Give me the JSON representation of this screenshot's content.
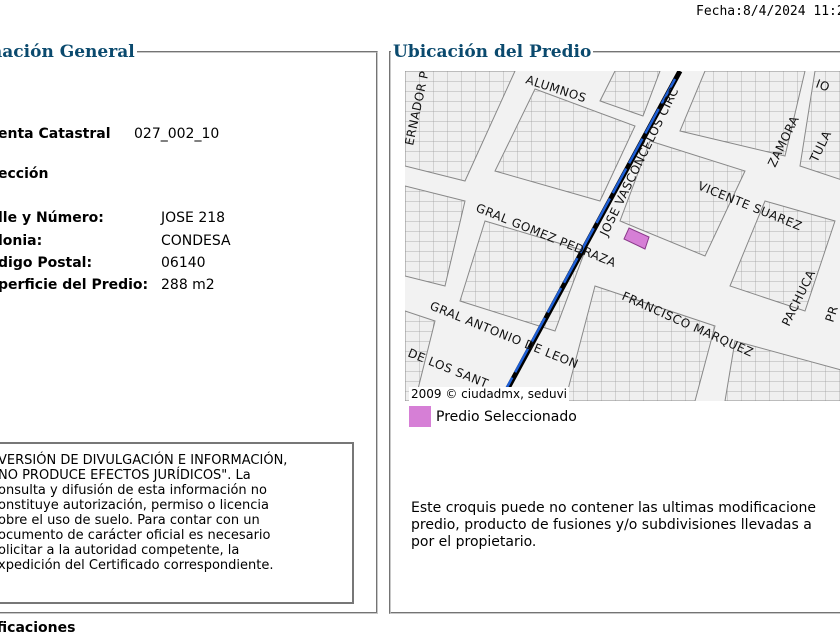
{
  "header": {
    "date": "Fecha:8/4/2024 11:2"
  },
  "general": {
    "legend": "ormación General",
    "cuenta_label": "enta Catastral",
    "cuenta_value": "027_002_10",
    "direccion_label": "ección",
    "calle_label": "lle y Número:",
    "calle_value": "JOSE 218",
    "colonia_label": "lonia:",
    "colonia_value": "CONDESA",
    "cp_label": "digo Postal:",
    "cp_value": "06140",
    "superficie_label": "perficie del Predio:",
    "superficie_value": "288 m2",
    "disclaimer_lines": [
      "VERSIÓN DE DIVULGACIÓN E INFORMACIÓN,",
      "NO PRODUCE EFECTOS JURÍDICOS\". La",
      "onsulta y difusión de esta información no",
      "onstituye autorización, permiso o licencia",
      "obre el uso de suelo. Para contar con un",
      "ocumento de carácter oficial es necesario",
      "olicitar a la autoridad competente, la",
      "xpedición del Certificado correspondiente."
    ]
  },
  "ubicacion": {
    "legend": "Ubicación del Predio",
    "map": {
      "streets": {
        "alumnos": "ALUMNOS",
        "gobernador": "ERNADOR PRO",
        "vasconcelos": "JOSE VASCONCELOS CIRC",
        "gomez_pedraza": "GRAL GOMEZ PEDRAZA",
        "vicente_suarez": "VICENTE SUAREZ",
        "zamora": "ZAMORA",
        "tula": "TULA",
        "francisco_marquez": "FRANCISCO MARQUEZ",
        "antonio_leon": "GRAL ANTONIO DE LEON",
        "de_los_santos": "DE LOS SANT",
        "pachuca": "PACHUCA",
        "pr": "PR",
        "corner": "IO"
      },
      "copyright": "2009 © ciudadmx, seduvi",
      "highlight_color": "#d67fd6",
      "road_color": "#1e5fd6"
    },
    "legend_item": "Predio Seleccionado",
    "note_lines": [
      "Este croquis puede no contener las ultimas modificacione",
      "predio, producto de fusiones y/o subdivisiones llevadas a",
      "por el propietario."
    ]
  },
  "footer": {
    "text": "ificaciones"
  }
}
